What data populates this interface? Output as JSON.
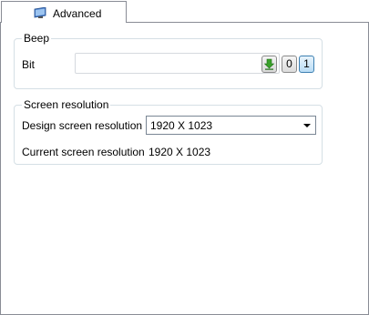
{
  "tab": {
    "label": "Advanced",
    "icon": "monitor-icon"
  },
  "beep": {
    "title": "Beep",
    "bit_label": "Bit",
    "bit_value": "",
    "download_icon": "download-arrow-icon",
    "zero_label": "0",
    "one_label": "1",
    "accent_green": "#3aa12a",
    "active_blue": "#3c7fb1"
  },
  "screen": {
    "title": "Screen resolution",
    "design_label": "Design screen resolution",
    "design_value": "1920 X 1023",
    "current_label": "Current screen resolution",
    "current_value": "1920 X 1023"
  }
}
